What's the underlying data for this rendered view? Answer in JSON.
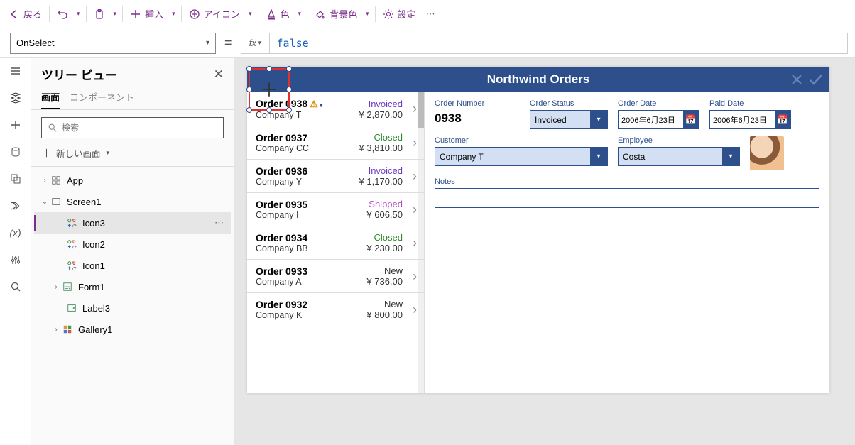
{
  "cmdbar": {
    "back": "戻る",
    "insert": "挿入",
    "icon": "アイコン",
    "color": "色",
    "bgcolor": "背景色",
    "settings": "設定"
  },
  "fxbar": {
    "property": "OnSelect",
    "formula": "false"
  },
  "treepanel": {
    "title": "ツリー ビュー",
    "tab_screens": "画面",
    "tab_components": "コンポーネント",
    "search_placeholder": "検索",
    "new_screen": "新しい画面",
    "nodes": {
      "app": "App",
      "screen1": "Screen1",
      "icon3": "Icon3",
      "icon2": "Icon2",
      "icon1": "Icon1",
      "form1": "Form1",
      "label3": "Label3",
      "gallery1": "Gallery1"
    }
  },
  "app": {
    "title": "Northwind Orders",
    "orders": [
      {
        "id": "Order 0938",
        "company": "Company T",
        "status": "Invoiced",
        "status_cls": "invoiced",
        "price": "¥ 2,870.00",
        "warn": true
      },
      {
        "id": "Order 0937",
        "company": "Company CC",
        "status": "Closed",
        "status_cls": "closed",
        "price": "¥ 3,810.00"
      },
      {
        "id": "Order 0936",
        "company": "Company Y",
        "status": "Invoiced",
        "status_cls": "invoiced",
        "price": "¥ 1,170.00"
      },
      {
        "id": "Order 0935",
        "company": "Company I",
        "status": "Shipped",
        "status_cls": "shipped",
        "price": "¥ 606.50"
      },
      {
        "id": "Order 0934",
        "company": "Company BB",
        "status": "Closed",
        "status_cls": "closed",
        "price": "¥ 230.00"
      },
      {
        "id": "Order 0933",
        "company": "Company A",
        "status": "New",
        "status_cls": "new",
        "price": "¥ 736.00"
      },
      {
        "id": "Order 0932",
        "company": "Company K",
        "status": "New",
        "status_cls": "new",
        "price": "¥ 800.00"
      }
    ],
    "detail": {
      "labels": {
        "order_number": "Order Number",
        "order_status": "Order Status",
        "order_date": "Order Date",
        "paid_date": "Paid Date",
        "customer": "Customer",
        "employee": "Employee",
        "notes": "Notes"
      },
      "order_number": "0938",
      "order_status": "Invoiced",
      "order_date": "2006年6月23日",
      "paid_date": "2006年6月23日",
      "customer": "Company T",
      "employee": "Costa"
    }
  }
}
